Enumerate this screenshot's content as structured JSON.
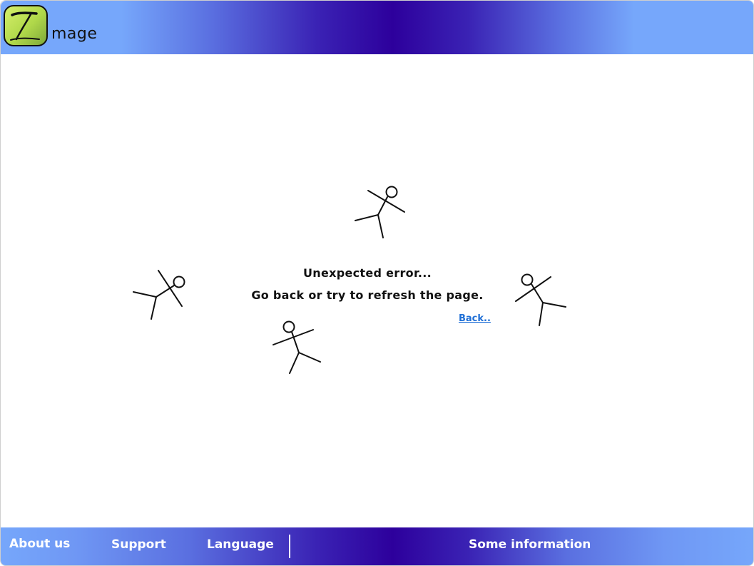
{
  "header": {
    "logo_icon": "stylized-letter-i-logo",
    "logo_text": "mage"
  },
  "main": {
    "error_title": "Unexpected error...",
    "error_message": "Go back or try to refresh the page.",
    "back_link": "Back.."
  },
  "footer": {
    "about": "About us",
    "support": "Support",
    "language": "Language",
    "info": "Some information"
  },
  "colors": {
    "header_light": "#76a7fb",
    "header_dark": "#2d009c",
    "logo_green": "#b0d84a",
    "link_blue": "#1f6fd6"
  }
}
